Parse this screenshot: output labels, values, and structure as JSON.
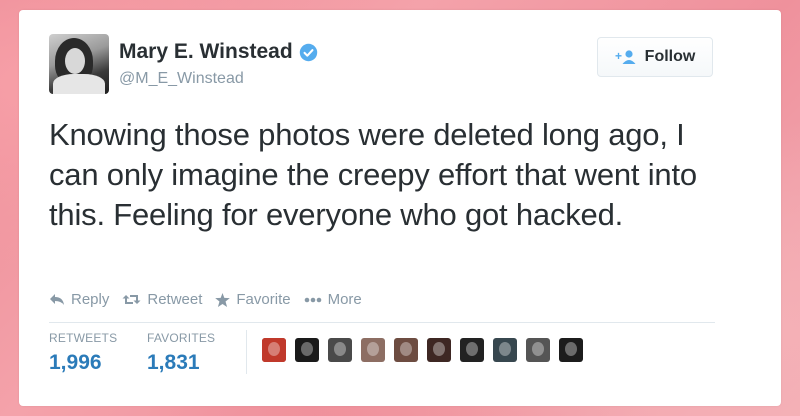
{
  "user": {
    "name": "Mary E. Winstead",
    "handle": "@M_E_Winstead",
    "verified": true
  },
  "follow": {
    "label": "Follow"
  },
  "tweet": {
    "text": "Knowing those photos were deleted long ago, I can only imagine the creepy effort that went into this. Feeling for everyone who got hacked."
  },
  "actions": [
    {
      "label": "Reply",
      "icon": "reply-icon"
    },
    {
      "label": "Retweet",
      "icon": "retweet-icon"
    },
    {
      "label": "Favorite",
      "icon": "star-icon"
    },
    {
      "label": "More",
      "icon": "more-icon"
    }
  ],
  "stats": {
    "retweets": {
      "label": "RETWEETS",
      "value": "1,996"
    },
    "favorites": {
      "label": "FAVORITES",
      "value": "1,831"
    }
  },
  "colors": {
    "link_blue": "#2b7bb9",
    "text": "#292f33",
    "muted": "#8899a6",
    "verified": "#55acee"
  },
  "favoriters": [
    {
      "color": "#c0392b"
    },
    {
      "color": "#1a1a1a"
    },
    {
      "color": "#4a4a4a"
    },
    {
      "color": "#8d6e63"
    },
    {
      "color": "#6d4c41"
    },
    {
      "color": "#3e2723"
    },
    {
      "color": "#222222"
    },
    {
      "color": "#37474f"
    },
    {
      "color": "#555555"
    },
    {
      "color": "#1c1c1c"
    }
  ]
}
